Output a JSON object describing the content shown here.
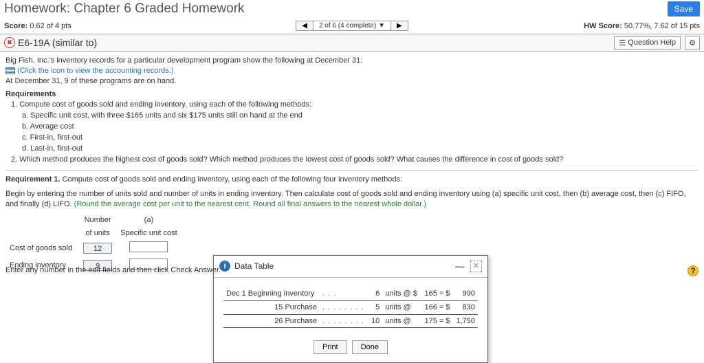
{
  "title": "Homework: Chapter 6 Graded Homework",
  "save": "Save",
  "score_left_label": "Score:",
  "score_left_value": "0.62 of 4 pts",
  "nav_position": "2 of 6 (4 complete) ▼",
  "hw_score_label": "HW Score:",
  "hw_score_value": "50.77%, 7.62 of 15 pts",
  "question_id": "E6-19A (similar to)",
  "question_help": "Question Help",
  "body": {
    "intro": "Big Fish, Inc.'s inventory records for a particular development program show the following at December 31:",
    "link": "(Click the icon to view the accounting records.)",
    "onhand": "At December 31, 9 of these programs are on hand.",
    "req_header": "Requirements",
    "r1": "1. Compute cost of goods sold and ending inventory, using each of the following methods:",
    "r1a": "a. Specific unit cost, with three $165 units and six $175 units still on hand at the end",
    "r1b": "b. Average cost",
    "r1c": "c. First-in, first-out",
    "r1d": "d. Last-in, first-out",
    "r2": "2. Which method produces the highest cost of goods sold? Which method produces the lowest cost of goods sold? What causes the difference in cost of goods sold?",
    "req1": "Requirement 1.",
    "req1_rest": " Compute cost of goods sold and ending inventory, using each of the following four inventory methods:",
    "begin": "Begin by entering the number of units sold and number of units in ending inventory. Then calculate cost of goods sold and ending inventory using (a) specific unit cost, then (b) average cost, then (c) FIFO, and finally (d) LIFO. ",
    "round": "(Round the average cost per unit to the nearest cent. Round all final answers to the nearest whole dollar.)"
  },
  "worktable": {
    "h_number": "Number",
    "h_a": "(a)",
    "h_units": "of units",
    "h_spec": "Specific unit cost",
    "row_cogs": "Cost of goods sold",
    "row_end": "Ending inventory",
    "v_cogs": "12",
    "v_end": "9"
  },
  "popup": {
    "title": "Data Table",
    "rows": [
      {
        "label": "Dec 1 Beginning inventory",
        "dots": ". . .",
        "qty": "6",
        "at": "units @ $",
        "price": "165 = $",
        "total": "990"
      },
      {
        "label": "15 Purchase",
        "dots": ". . . . . . . .",
        "qty": "5",
        "at": "units @",
        "price": "166 = $",
        "total": "830"
      },
      {
        "label": "26 Purchase",
        "dots": ". . . . . . . .",
        "qty": "10",
        "at": "units @",
        "price": "175 = $",
        "total": "1,750"
      }
    ],
    "print": "Print",
    "done": "Done"
  },
  "footer": "Enter any number in the edit fields and then click Check Answer."
}
